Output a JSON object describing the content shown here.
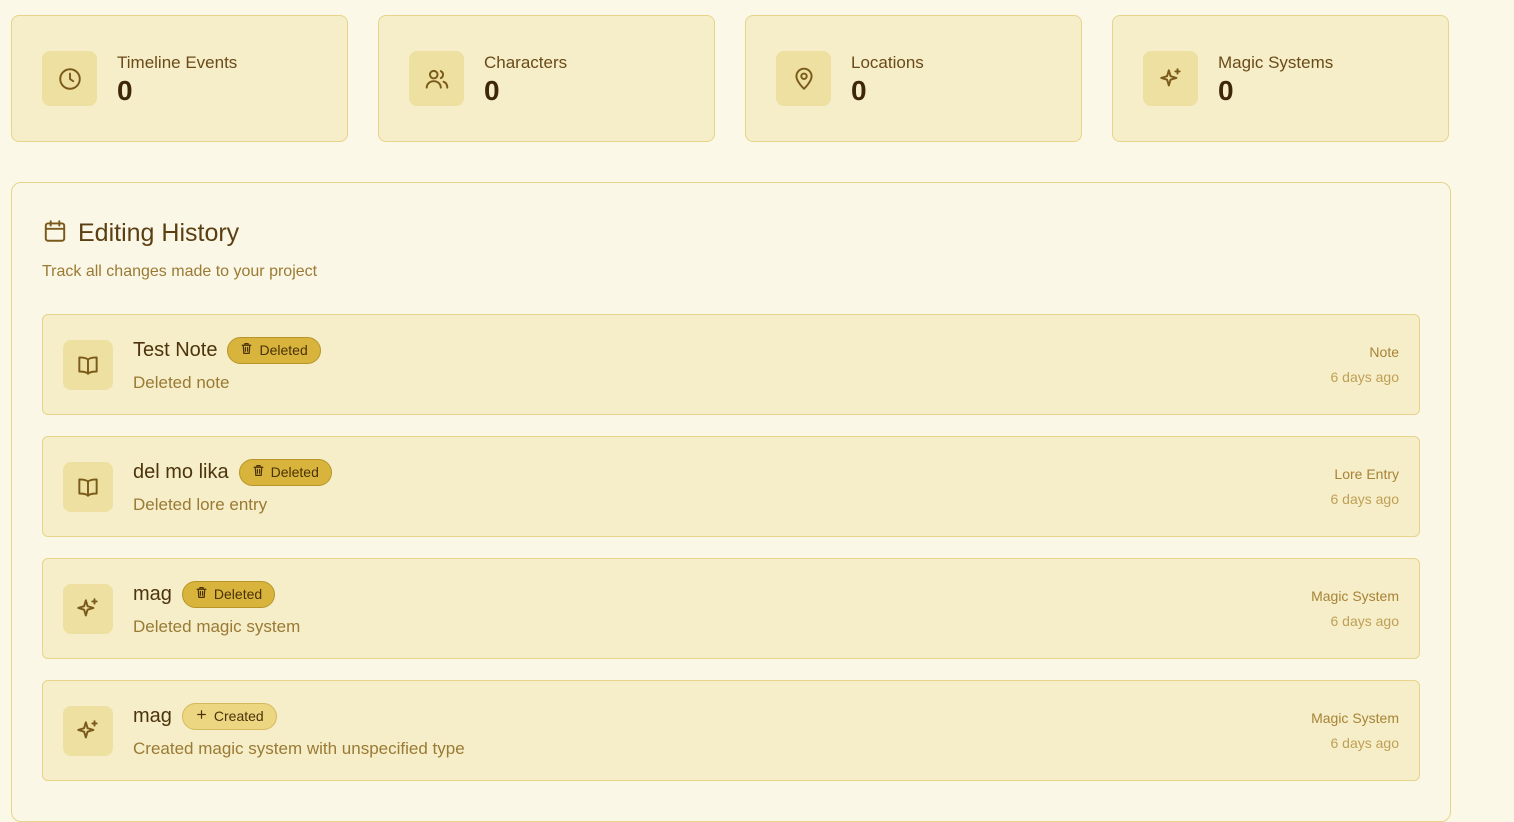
{
  "stats": [
    {
      "label": "Timeline Events",
      "value": "0",
      "icon": "clock-icon"
    },
    {
      "label": "Characters",
      "value": "0",
      "icon": "users-icon"
    },
    {
      "label": "Locations",
      "value": "0",
      "icon": "map-pin-icon"
    },
    {
      "label": "Magic Systems",
      "value": "0",
      "icon": "sparkles-icon"
    }
  ],
  "history": {
    "title": "Editing History",
    "subtitle": "Track all changes made to your project",
    "entries": [
      {
        "name": "Test Note",
        "badge": "Deleted",
        "badge_type": "deleted",
        "description": "Deleted note",
        "type": "Note",
        "time": "6 days ago",
        "icon": "book-open-icon"
      },
      {
        "name": "del mo lika",
        "badge": "Deleted",
        "badge_type": "deleted",
        "description": "Deleted lore entry",
        "type": "Lore Entry",
        "time": "6 days ago",
        "icon": "book-open-icon"
      },
      {
        "name": "mag",
        "badge": "Deleted",
        "badge_type": "deleted",
        "description": "Deleted magic system",
        "type": "Magic System",
        "time": "6 days ago",
        "icon": "sparkles-icon"
      },
      {
        "name": "mag",
        "badge": "Created",
        "badge_type": "created",
        "description": "Created magic system with unspecified type",
        "type": "Magic System",
        "time": "6 days ago",
        "icon": "sparkles-icon"
      }
    ]
  },
  "colors": {
    "background": "#fcf8e8",
    "card": "#f5eec9",
    "accent": "#d8b43c",
    "text": "#5a3f12"
  }
}
